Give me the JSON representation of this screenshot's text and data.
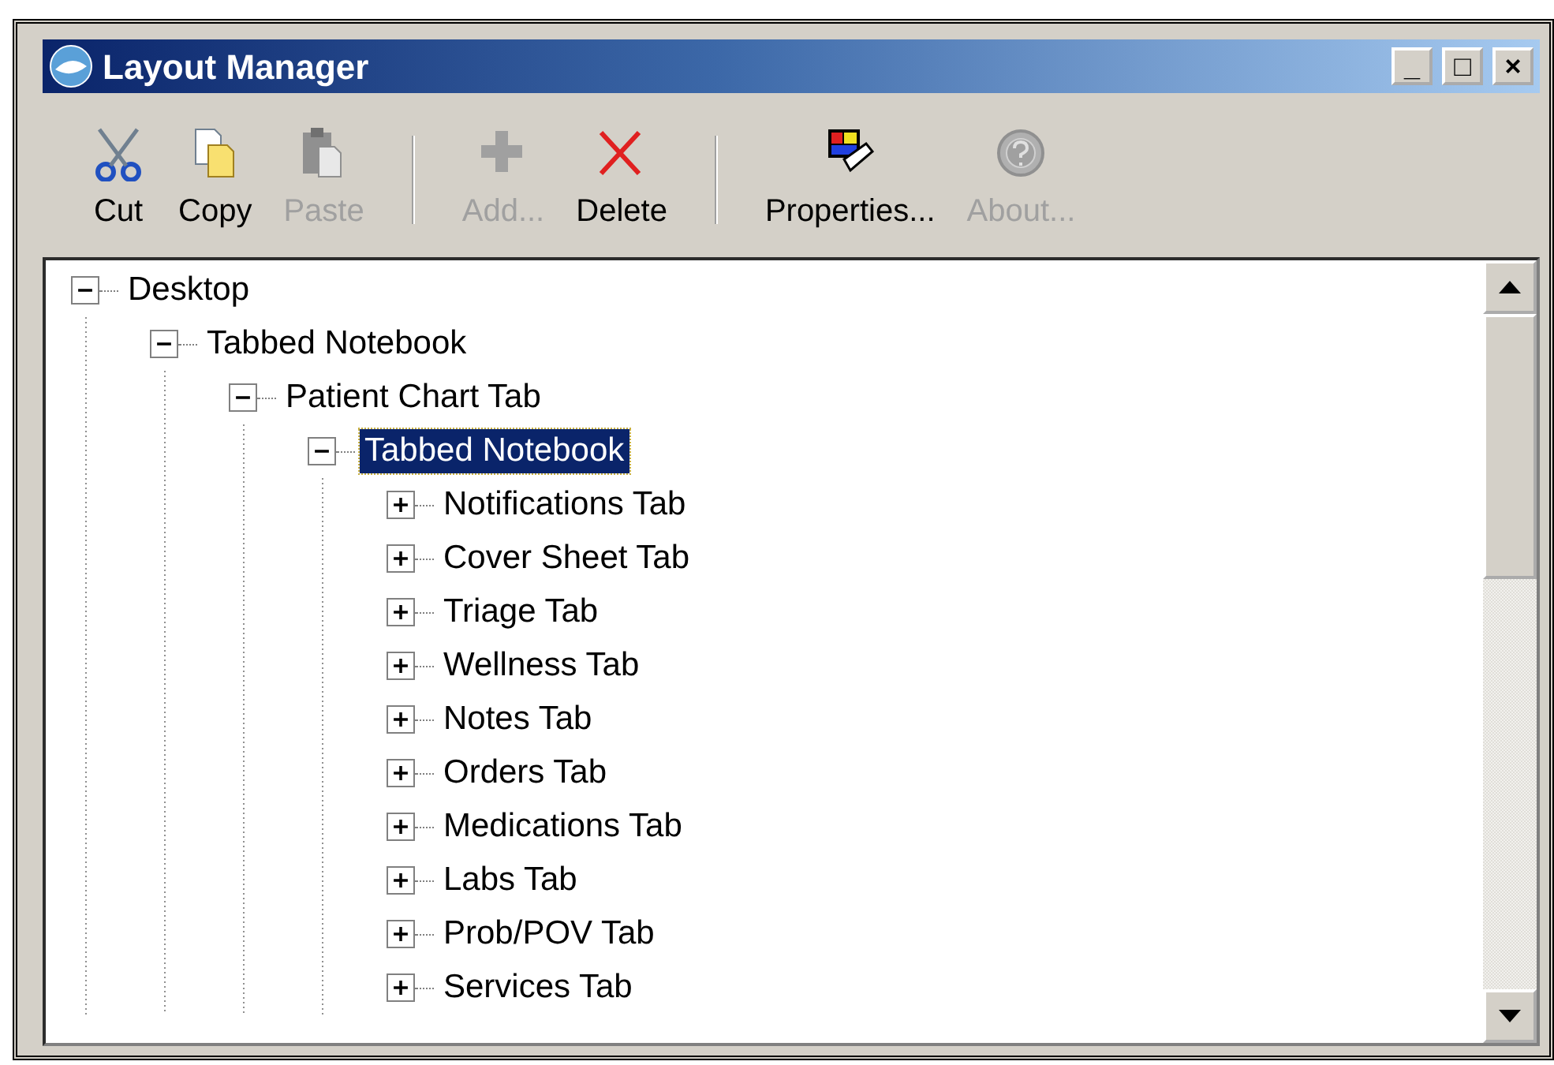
{
  "window": {
    "title": "Layout Manager"
  },
  "title_buttons": [
    "_",
    "□",
    "×"
  ],
  "toolbar": [
    {
      "label": "Cut",
      "disabled": false
    },
    {
      "label": "Copy",
      "disabled": false
    },
    {
      "label": "Paste",
      "disabled": true
    },
    {
      "kind": "separator"
    },
    {
      "label": "Add...",
      "disabled": true
    },
    {
      "label": "Delete",
      "disabled": false
    },
    {
      "kind": "separator"
    },
    {
      "label": "Properties...",
      "disabled": false
    },
    {
      "label": "About...",
      "disabled": true
    }
  ],
  "tree": [
    {
      "label": "Desktop",
      "expanded": true,
      "selected": false,
      "children": [
        {
          "label": "Tabbed Notebook",
          "expanded": true,
          "selected": false,
          "children": [
            {
              "label": "Patient Chart Tab",
              "expanded": true,
              "selected": false,
              "children": [
                {
                  "label": "Tabbed Notebook",
                  "expanded": true,
                  "selected": true,
                  "children": [
                    {
                      "label": "Notifications Tab",
                      "expanded": false,
                      "selected": false
                    },
                    {
                      "label": "Cover Sheet Tab",
                      "expanded": false,
                      "selected": false
                    },
                    {
                      "label": "Triage Tab",
                      "expanded": false,
                      "selected": false
                    },
                    {
                      "label": "Wellness Tab",
                      "expanded": false,
                      "selected": false
                    },
                    {
                      "label": "Notes Tab",
                      "expanded": false,
                      "selected": false
                    },
                    {
                      "label": "Orders Tab",
                      "expanded": false,
                      "selected": false
                    },
                    {
                      "label": "Medications Tab",
                      "expanded": false,
                      "selected": false
                    },
                    {
                      "label": "Labs Tab",
                      "expanded": false,
                      "selected": false
                    },
                    {
                      "label": "Prob/POV Tab",
                      "expanded": false,
                      "selected": false
                    },
                    {
                      "label": "Services Tab",
                      "expanded": false,
                      "selected": false
                    }
                  ]
                }
              ]
            }
          ]
        }
      ]
    }
  ]
}
